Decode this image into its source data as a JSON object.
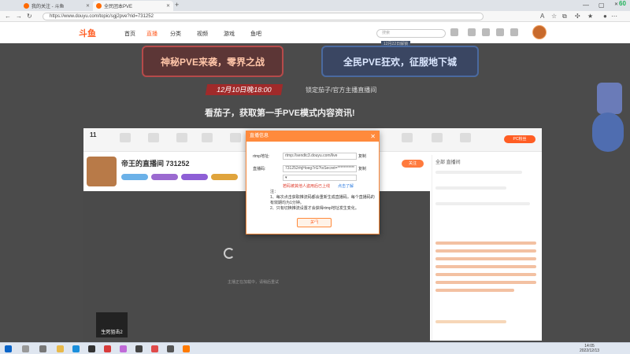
{
  "browser": {
    "tabs": [
      {
        "title": "我的关注 - 斗鱼"
      },
      {
        "title": "全民团本PVE"
      }
    ],
    "url": "https://www.douyu.com/topic/sgj2pve?rid=731252",
    "zoom_badge": "60"
  },
  "site": {
    "logo": "斗鱼",
    "nav": [
      "首页",
      "直播",
      "分类",
      "视频",
      "游戏",
      "鱼吧"
    ],
    "active_nav_index": 1,
    "search_placeholder": "搜索"
  },
  "banner": {
    "left_title": "神秘PVE来袭，零界之战",
    "right_tag": "12月22日解锁",
    "right_title": "全民PVE狂欢，征服地下城",
    "date_text": "12月10日晚18:00",
    "anchor_text": "锁定茄子/官方主播直播间",
    "headline": "看茄子，获取第一手PVE模式内容资讯!"
  },
  "page": {
    "level_number": "11",
    "pc_button": "PC粉丝",
    "streamer_title": "帝王的直播间 731252",
    "follow_label": "关注",
    "video_caption": "主播正在加载中，请稍后重试",
    "corner_logo_label": "生死狙击2",
    "chat_head": "全部 直播间"
  },
  "dialog": {
    "title": "直播信息",
    "rtmp_label": "rtmp地址:",
    "rtmp_value": "rtmp://sendtc3.douyu.com/live",
    "code_label": "直播码:",
    "code_value": "731252rhjHoeg7rG?txSecret=***********",
    "copy_label": "复制",
    "warning": "若码被其他人盗用后已上线",
    "warning_link": "点击了解",
    "notes": [
      "注：",
      "1、每次点击获取推流码都会重新生成直播码，每个直播码的有效期均为1分钟。",
      "2、只有切换推流设置才会获得rtmp地址发生变化。"
    ],
    "ok_label": "关闭"
  },
  "taskbar": {
    "time": "14:05",
    "date": "2022/12/13"
  }
}
